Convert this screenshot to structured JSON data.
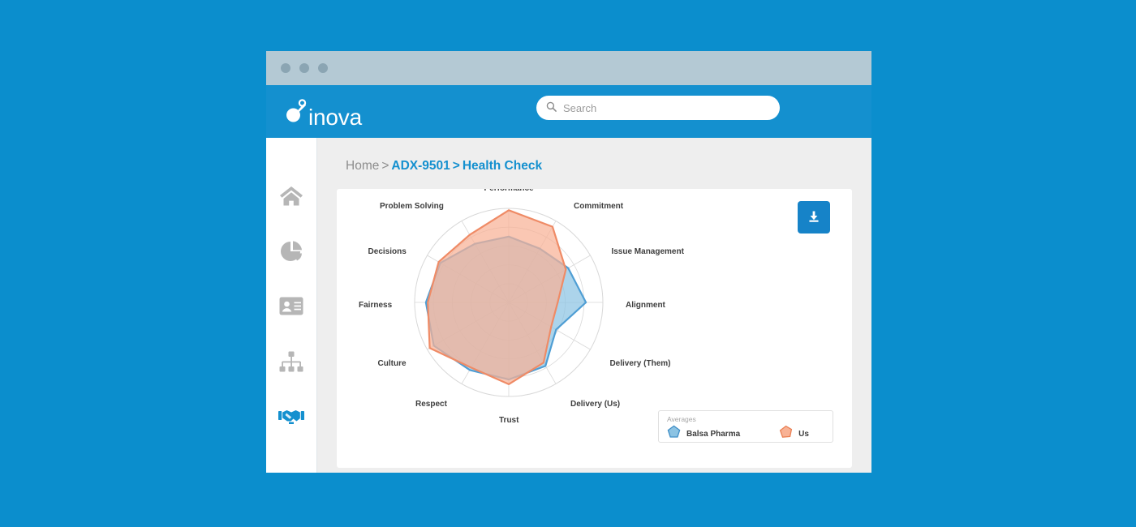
{
  "window": {
    "chrome_dots": [
      "close-dot",
      "minimize-dot",
      "maximize-dot"
    ]
  },
  "header": {
    "brand": "inova",
    "brand_icon": "inova-droplet-logo",
    "search": {
      "placeholder": "Search",
      "value": "",
      "icon": "search-icon"
    }
  },
  "sidebar": {
    "items": [
      {
        "name": "home",
        "icon": "home-icon",
        "active": false
      },
      {
        "name": "analytics",
        "icon": "pie-chart-icon",
        "active": false
      },
      {
        "name": "contacts",
        "icon": "id-card-icon",
        "active": false
      },
      {
        "name": "organization",
        "icon": "sitemap-icon",
        "active": false
      },
      {
        "name": "partnerships",
        "icon": "handshake-icon",
        "active": true
      }
    ],
    "active_color": "#1490cf",
    "inactive_color": "#b6b6b6"
  },
  "breadcrumb": {
    "home": "Home",
    "separator": ">",
    "project": "ADX-9501",
    "page": "Health Check"
  },
  "toolbar": {
    "download_label": "Download",
    "download_icon": "download-icon",
    "download_color": "#1683c8"
  },
  "chart_data": {
    "type": "radar",
    "title": "",
    "categories": [
      "Performance",
      "Commitment",
      "Issue Management",
      "Alignment",
      "Delivery (Them)",
      "Delivery (Us)",
      "Trust",
      "Respect",
      "Culture",
      "Fairness",
      "Decisions",
      "Problem Solving"
    ],
    "series": [
      {
        "name": "Balsa Pharma",
        "color": "#4f9ed4",
        "fill": "#8cc3e3",
        "values": [
          0.7,
          0.66,
          0.73,
          0.82,
          0.58,
          0.78,
          0.82,
          0.83,
          0.92,
          0.88,
          0.84,
          0.72
        ]
      },
      {
        "name": "Us",
        "color": "#ef8b66",
        "fill": "#f8b295",
        "values": [
          0.98,
          0.93,
          0.7,
          0.52,
          0.52,
          0.74,
          0.87,
          0.8,
          0.97,
          0.86,
          0.86,
          0.83
        ]
      }
    ],
    "rmax": 1.0,
    "rings": [
      0.2,
      0.4,
      0.6,
      0.8,
      1.0
    ],
    "grid": true,
    "legend": {
      "title": "Averages",
      "position": "bottom-right",
      "entries": [
        "Balsa Pharma",
        "Us"
      ]
    }
  }
}
